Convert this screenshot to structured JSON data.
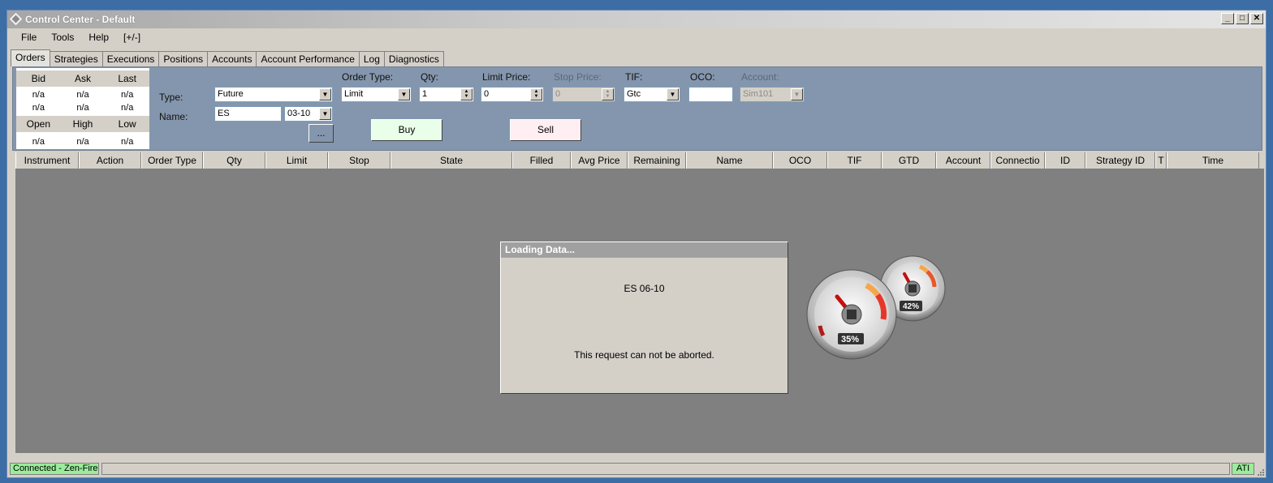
{
  "window": {
    "title": "Control Center - Default",
    "btn_min": "_",
    "btn_max": "□",
    "btn_close": "✕"
  },
  "menu": [
    "File",
    "Tools",
    "Help",
    "[+/-]"
  ],
  "tabs": [
    "Orders",
    "Strategies",
    "Executions",
    "Positions",
    "Accounts",
    "Account Performance",
    "Log",
    "Diagnostics"
  ],
  "active_tab": "Orders",
  "quote": {
    "headers1": [
      "Bid",
      "Ask",
      "Last"
    ],
    "row1": [
      "n/a",
      "n/a",
      "n/a"
    ],
    "row2": [
      "n/a",
      "n/a",
      "n/a"
    ],
    "headers2": [
      "Open",
      "High",
      "Low"
    ],
    "row3": [
      "n/a",
      "n/a",
      "n/a"
    ]
  },
  "order_entry": {
    "type_label": "Type:",
    "type_value": "Future",
    "name_label": "Name:",
    "name_value": "ES",
    "expiry_value": "03-10",
    "more_button": "...",
    "order_type_label": "Order Type:",
    "order_type_value": "Limit",
    "qty_label": "Qty:",
    "qty_value": "1",
    "limit_price_label": "Limit Price:",
    "limit_price_value": "0",
    "stop_price_label": "Stop Price:",
    "stop_price_value": "0",
    "tif_label": "TIF:",
    "tif_value": "Gtc",
    "oco_label": "OCO:",
    "oco_value": "",
    "account_label": "Account:",
    "account_value": "Sim101",
    "buy_label": "Buy",
    "sell_label": "Sell",
    "buy_color": "#eaffea",
    "sell_color": "#ffeef2"
  },
  "grid_columns": [
    "Instrument",
    "Action",
    "Order Type",
    "Qty",
    "Limit",
    "Stop",
    "State",
    "Filled",
    "Avg Price",
    "Remaining",
    "Name",
    "OCO",
    "TIF",
    "GTD",
    "Account",
    "Connectio",
    "ID",
    "Strategy ID",
    "T",
    "Time"
  ],
  "dialog": {
    "title": "Loading Data...",
    "instrument": "ES 06-10",
    "message": "This request can not be aborted."
  },
  "gadget": {
    "cpu_value": "35%",
    "memory_value": "42%",
    "cpu_level": 0.35,
    "memory_level": 0.42,
    "cpu_icon": "cpu-chip-icon",
    "memory_icon": "memory-chip-icon"
  },
  "status": {
    "connection": "Connected - Zen-Fire",
    "ati": "ATI",
    "status_color": "#9bec9b"
  }
}
